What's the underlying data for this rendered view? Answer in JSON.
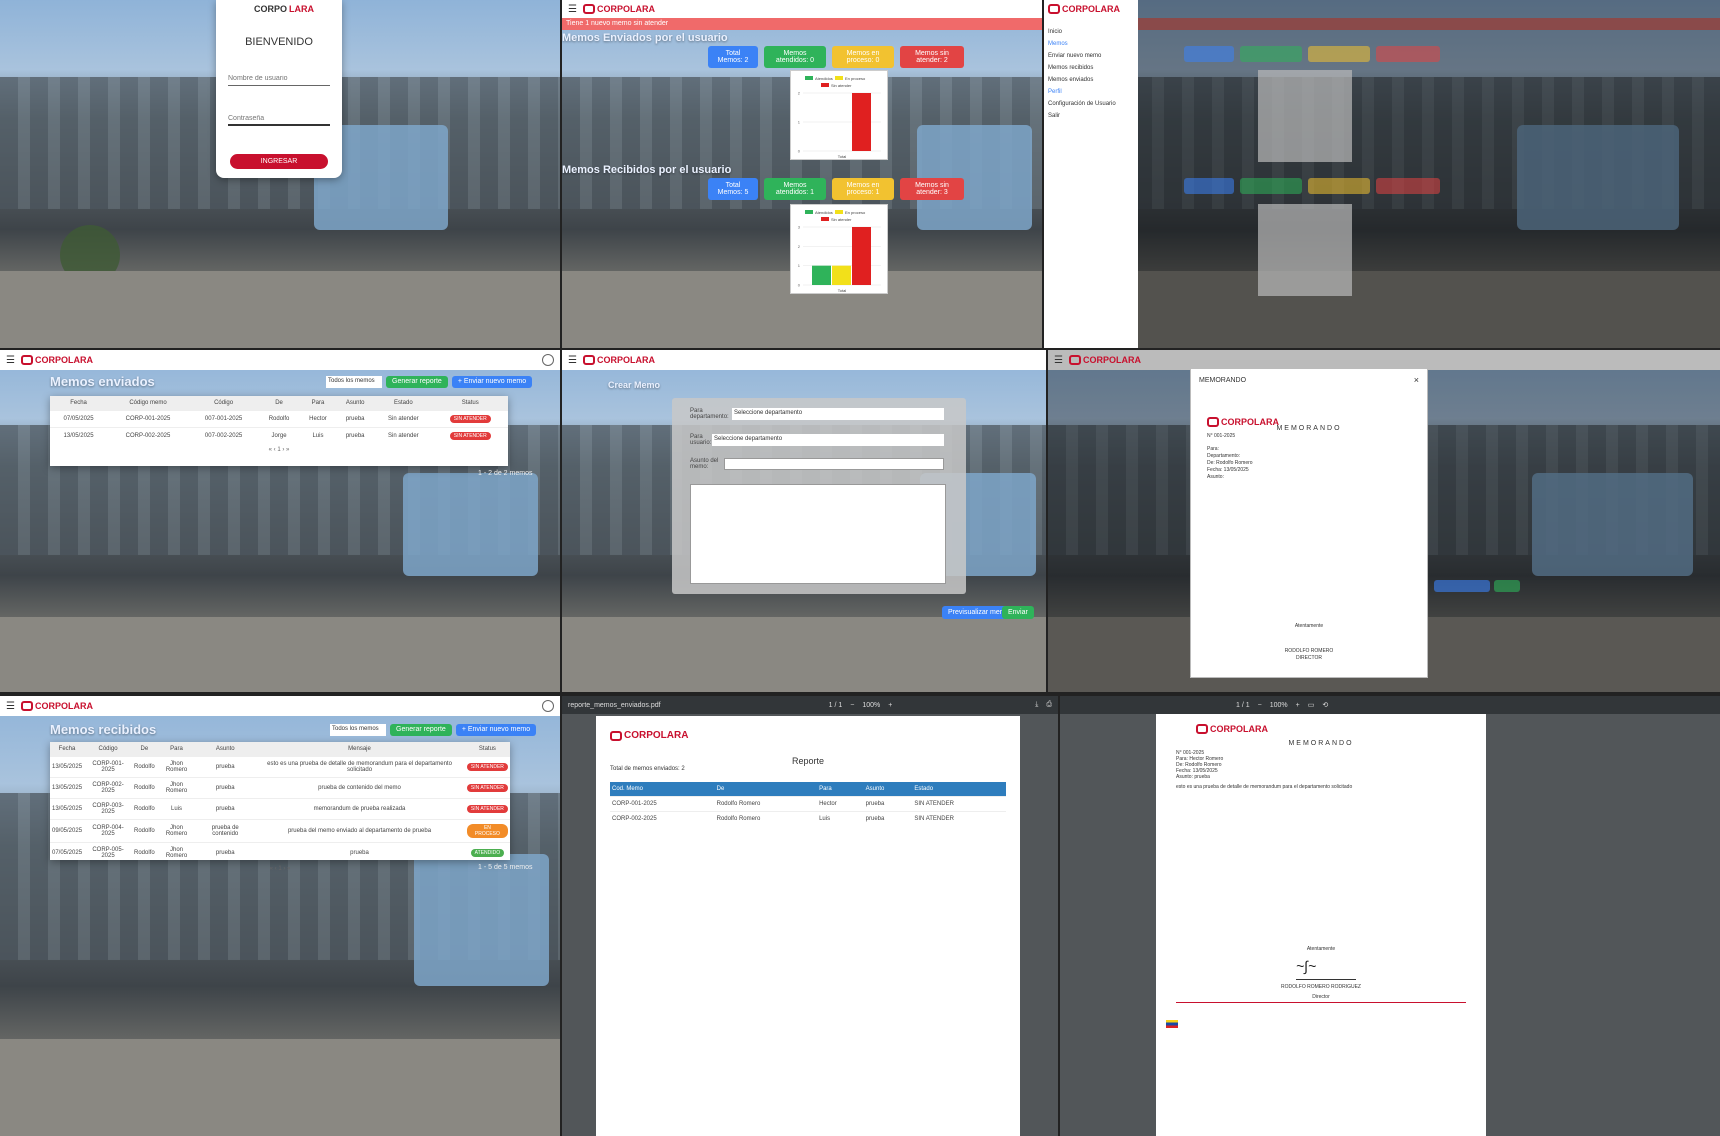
{
  "login": {
    "logo_a": "CORPO",
    "logo_b": "LARA",
    "welcome": "BIENVENIDO",
    "user_placeholder": "Nombre de usuario",
    "pass_placeholder": "Contraseña",
    "submit": "INGRESAR"
  },
  "dashboard": {
    "alert": "Tiene 1 nuevo memo sin atender",
    "sent_title": "Memos Enviados por el usuario",
    "received_title": "Memos Recibidos por el usuario",
    "sent_buttons": [
      "Total Memos: 2",
      "Memos atendidos: 0",
      "Memos en proceso: 0",
      "Memos sin atender: 2"
    ],
    "received_buttons": [
      "Total Memos: 5",
      "Memos atendidos: 1",
      "Memos en proceso: 1",
      "Memos sin atender: 3"
    ],
    "legend": [
      "Atendidos",
      "En proceso",
      "Sin atender"
    ],
    "xlabel": "Total",
    "colors": {
      "green": "#2fb35a",
      "yellow": "#f2e01a",
      "red": "#e02020",
      "blue": "#3b82f6"
    }
  },
  "chart_data": [
    {
      "type": "bar",
      "categories": [
        "Total"
      ],
      "series": [
        {
          "name": "Atendidos",
          "values": [
            0
          ]
        },
        {
          "name": "En proceso",
          "values": [
            0
          ]
        },
        {
          "name": "Sin atender",
          "values": [
            2
          ]
        }
      ],
      "ylim": [
        0,
        2
      ]
    },
    {
      "type": "bar",
      "categories": [
        "Total"
      ],
      "series": [
        {
          "name": "Atendidos",
          "values": [
            1
          ]
        },
        {
          "name": "En proceso",
          "values": [
            1
          ]
        },
        {
          "name": "Sin atender",
          "values": [
            3
          ]
        }
      ],
      "ylim": [
        0,
        3
      ]
    }
  ],
  "sidebar": {
    "items": [
      "Inicio",
      "Memos",
      "Enviar nuevo memo",
      "Memos recibidos",
      "Memos enviados",
      "Perfil",
      "Configuración de Usuario",
      "Salir"
    ]
  },
  "sent_list": {
    "title": "Memos enviados",
    "filter": "Todos los memos",
    "btn_report": "Generar reporte",
    "btn_new": "+ Enviar nuevo memo",
    "headers": [
      "Fecha",
      "Código memo",
      "Código",
      "De",
      "Para",
      "Asunto",
      "Estado",
      "Status"
    ],
    "rows": [
      [
        "07/05/2025",
        "CORP-001-2025",
        "007-001-2025",
        "Rodolfo",
        "Hector",
        "prueba",
        "Sin atender",
        "SIN ATENDER"
      ],
      [
        "13/05/2025",
        "CORP-002-2025",
        "007-002-2025",
        "Jorge",
        "Luis",
        "prueba",
        "Sin atender",
        "SIN ATENDER"
      ]
    ],
    "footer": "1 - 2 de 2 memos"
  },
  "create": {
    "title": "Crear Memo",
    "dept_label": "Para departamento:",
    "dept_placeholder": "Seleccione departamento",
    "user_label": "Para usuario:",
    "user_placeholder": "Seleccione departamento",
    "subject_label": "Asunto del memo:",
    "btn_preview": "Previsualizar memo",
    "btn_send": "Enviar"
  },
  "preview": {
    "header": "MEMORANDO",
    "doc_title": "MEMORANDO",
    "lines": [
      "N° 001-2025",
      "Para:",
      "Departamento:",
      "De: Rodolfo Romero",
      "Fecha: 13/05/2025",
      "Asunto:"
    ],
    "signature_label": "Atentamente",
    "signature_name": "RODOLFO ROMERO",
    "signature_role": "DIRECTOR"
  },
  "received_list": {
    "title": "Memos recibidos",
    "filter": "Todos los memos",
    "btn_report": "Generar reporte",
    "btn_new": "+ Enviar nuevo memo",
    "headers": [
      "Fecha",
      "Código",
      "De",
      "Para",
      "Asunto",
      "Mensaje",
      "Status"
    ],
    "rows": [
      [
        "13/05/2025",
        "CORP-001-2025",
        "Rodolfo",
        "Jhon Romero",
        "prueba",
        "esto es una prueba de detalle de memorandum para el departamento solicitado",
        "SIN ATENDER"
      ],
      [
        "13/05/2025",
        "CORP-002-2025",
        "Rodolfo",
        "Jhon Romero",
        "prueba",
        "prueba de contenido del memo",
        "SIN ATENDER"
      ],
      [
        "13/05/2025",
        "CORP-003-2025",
        "Rodolfo",
        "Luis",
        "prueba",
        "memorandum de prueba realizada",
        "SIN ATENDER"
      ],
      [
        "09/05/2025",
        "CORP-004-2025",
        "Rodolfo",
        "Jhon Romero",
        "prueba de contenido",
        "prueba del memo enviado al departamento de prueba",
        "EN PROCESO"
      ],
      [
        "07/05/2025",
        "CORP-005-2025",
        "Rodolfo",
        "Jhon Romero",
        "prueba",
        "prueba",
        "ATENDIDO"
      ]
    ],
    "footer": "1 - 5 de 5 memos"
  },
  "report": {
    "file": "reporte_memos_enviados.pdf",
    "page": "1 / 1",
    "zoom": "100%",
    "title": "Reporte",
    "subtitle": "Total de memos enviados: 2",
    "headers": [
      "Cod. Memo",
      "De",
      "Para",
      "Asunto",
      "Estado"
    ],
    "rows": [
      [
        "CORP-001-2025",
        "Rodolfo Romero",
        "Hector",
        "prueba",
        "SIN ATENDER"
      ],
      [
        "CORP-002-2025",
        "Rodolfo Romero",
        "Luis",
        "prueba",
        "SIN ATENDER"
      ]
    ]
  },
  "memo_pdf": {
    "page": "1 / 1",
    "zoom": "100%",
    "title": "MEMORANDO",
    "lines": [
      "N° 001-2025",
      "Para: Hector Romero",
      "De: Rodolfo Romero",
      "Fecha: 13/05/2025",
      "Asunto: prueba"
    ],
    "body": "esto es una prueba de detalle de memorandum para el departamento solicitado",
    "closing": "Atentamente",
    "sign_name": "RODOLFO ROMERO RODRIGUEZ",
    "sign_role": "Director"
  }
}
